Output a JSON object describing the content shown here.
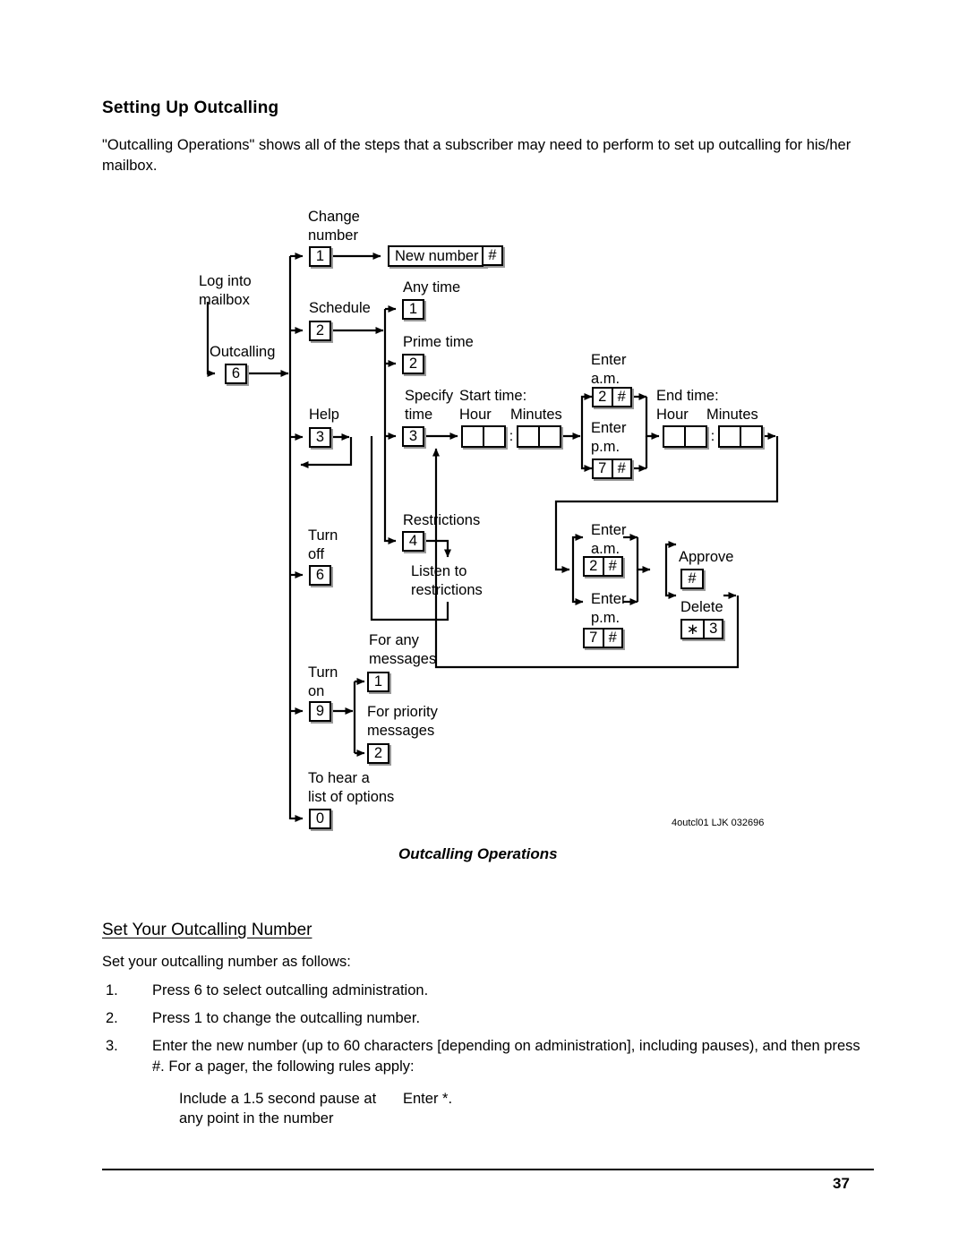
{
  "document": {
    "page_number": "37",
    "heading": "Setting Up Outcalling",
    "intro": "\"Outcalling Operations\" shows all of the steps that a subscriber may need to perform to set up outcalling for his/her mailbox.",
    "section_heading": "Set Your Outcalling Number",
    "section_lead": "Set your outcalling number as follows:",
    "steps": [
      {
        "number": "1.",
        "text": "Press 6 to select outcalling administration."
      },
      {
        "number": "2.",
        "text": "Press 1 to change the outcalling number."
      },
      {
        "number": "3.",
        "text": "Enter the new number (up to 60 characters [depending on administration], including pauses), and then press #.  For a pager, the following rules apply:"
      }
    ],
    "rule_table": {
      "left": "Include a 1.5 second pause\nat any point in the number",
      "right": "Enter *."
    }
  },
  "figure": {
    "caption": "Outcalling Operations",
    "id_text": "4outcl01 LJK 032696",
    "labels": {
      "log_into_mailbox": "Log into\nmailbox",
      "outcalling": "Outcalling",
      "change_number": "Change\nnumber",
      "new_number": "New number",
      "hash": "#",
      "schedule": "Schedule",
      "any_time": "Any time",
      "prime_time": "Prime time",
      "specify_time": "Specify\ntime",
      "start_time": "Start time:",
      "end_time": "End time:",
      "hour": "Hour",
      "minutes": "Minutes",
      "colon": ":",
      "enter_am": "Enter\na.m.",
      "enter_pm": "Enter\np.m.",
      "help": "Help",
      "turn_off": "Turn\noff",
      "restrictions": "Restrictions",
      "listen_to_restrictions": "Listen to\nrestrictions",
      "turn_on": "Turn\non",
      "for_any_messages": "For any\nmessages",
      "for_priority_messages": "For priority\nmessages",
      "to_hear_list": "To hear a\nlist of options",
      "approve": "Approve",
      "delete": "Delete",
      "star": "∗"
    },
    "keys": {
      "outcalling": "6",
      "change_number": "1",
      "schedule": "2",
      "any_time": "1",
      "prime_time": "2",
      "specify_time": "3",
      "help": "3",
      "turn_off": "6",
      "restrictions": "4",
      "turn_on": "9",
      "for_any_messages": "1",
      "for_priority_messages": "2",
      "to_hear_list": "0",
      "am": "2",
      "pm": "7",
      "hash": "#",
      "approve": "#",
      "delete_star": "∗",
      "delete_digit": "3"
    }
  },
  "colors": {
    "ink": "#000000",
    "paper": "#ffffff",
    "shadow": "#9a9a9a"
  }
}
